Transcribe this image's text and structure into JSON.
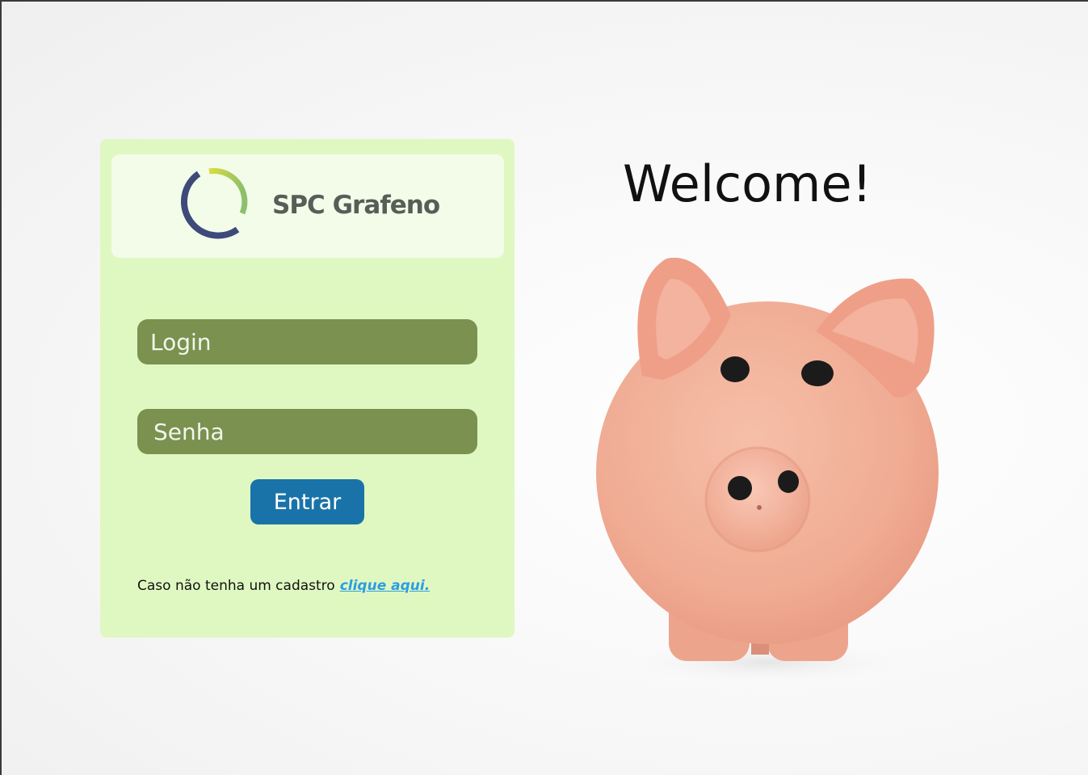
{
  "brand": {
    "name": "SPC Grafeno",
    "logo_icon": "ring-logo-icon"
  },
  "form": {
    "login_placeholder": "Login",
    "password_placeholder": "Senha",
    "submit_label": "Entrar",
    "signup_text": "Caso não tenha um cadastro",
    "signup_link": "clique aqui."
  },
  "hero": {
    "heading": "Welcome!",
    "image": "piggy-bank-illustration"
  },
  "colors": {
    "card_bg": "#dff8c2",
    "field_bg": "#7a9150",
    "button_bg": "#1a73a8",
    "link": "#2e9de0"
  }
}
